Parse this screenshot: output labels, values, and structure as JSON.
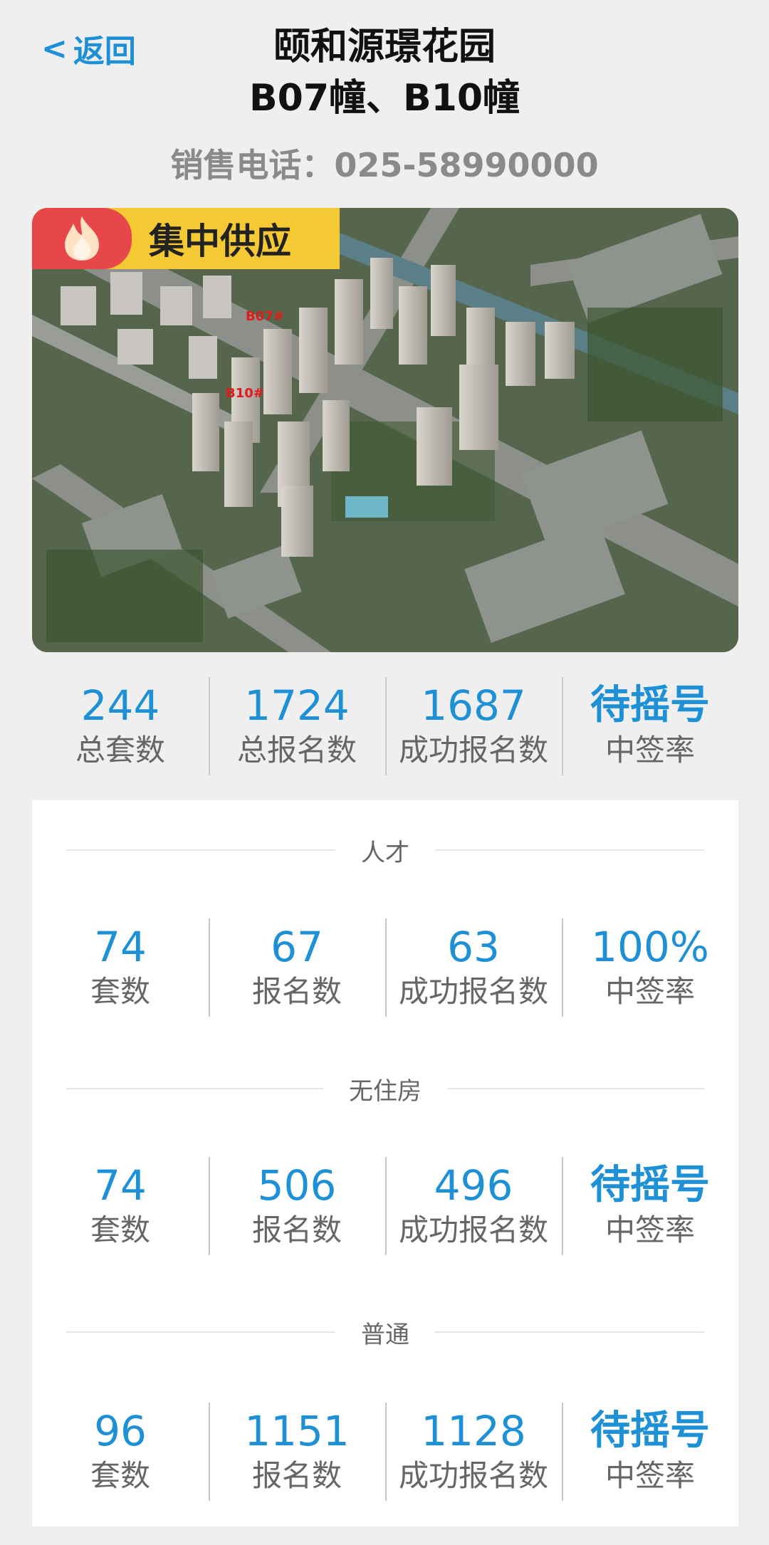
{
  "header": {
    "back_label": "返回",
    "title_line1": "颐和源璟花园",
    "title_line2": "B07幢、B10幢",
    "phone": "销售电话：025-58990000"
  },
  "hero": {
    "badge_label": "集中供应",
    "building_tags": [
      "B07#",
      "B10#"
    ]
  },
  "summary": {
    "items": [
      {
        "value": "244",
        "label": "总套数"
      },
      {
        "value": "1724",
        "label": "总报名数"
      },
      {
        "value": "1687",
        "label": "成功报名数"
      },
      {
        "value": "待摇号",
        "label": "中签率"
      }
    ]
  },
  "sections": [
    {
      "title": "人才",
      "items": [
        {
          "value": "74",
          "label": "套数"
        },
        {
          "value": "67",
          "label": "报名数"
        },
        {
          "value": "63",
          "label": "成功报名数"
        },
        {
          "value": "100%",
          "label": "中签率"
        }
      ]
    },
    {
      "title": "无住房",
      "items": [
        {
          "value": "74",
          "label": "套数"
        },
        {
          "value": "506",
          "label": "报名数"
        },
        {
          "value": "496",
          "label": "成功报名数"
        },
        {
          "value": "待摇号",
          "label": "中签率"
        }
      ]
    },
    {
      "title": "普通",
      "items": [
        {
          "value": "96",
          "label": "套数"
        },
        {
          "value": "1151",
          "label": "报名数"
        },
        {
          "value": "1128",
          "label": "成功报名数"
        },
        {
          "value": "待摇号",
          "label": "中签率"
        }
      ]
    }
  ],
  "colors": {
    "accent": "#1e90d6",
    "background": "#efefef",
    "badge": "#f5c934",
    "flame": "#e8474a"
  }
}
